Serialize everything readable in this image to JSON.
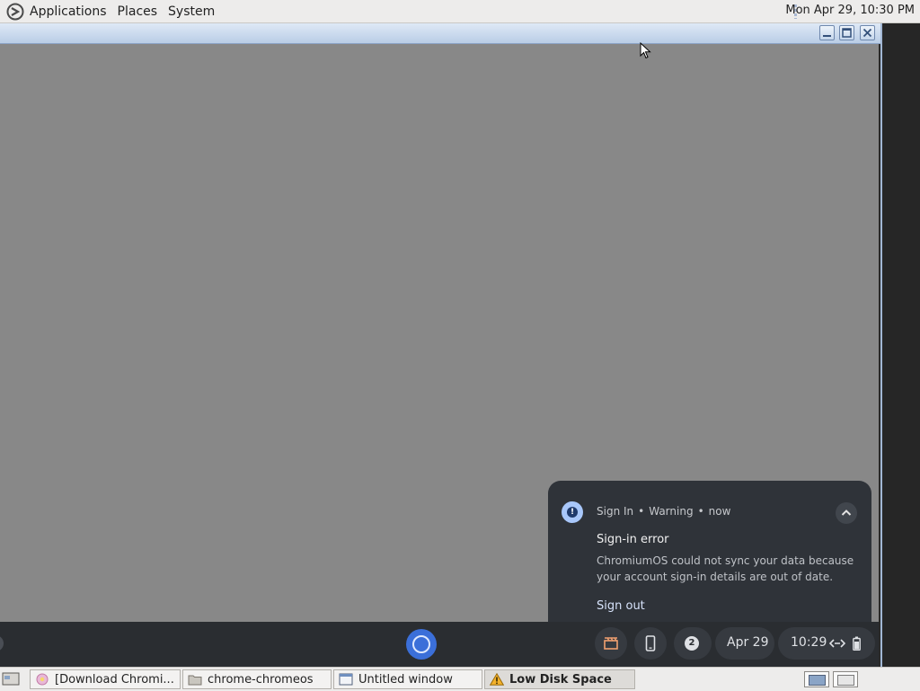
{
  "top_panel": {
    "menus": [
      "Applications",
      "Places",
      "System"
    ],
    "clock": "Mon Apr 29, 10:30 PM"
  },
  "notification": {
    "source": "Sign In",
    "severity": "Warning",
    "time": "now",
    "title": "Sign-in error",
    "message": "ChromiumOS could not sync your data because your account sign-in details are out of date.",
    "action": "Sign out",
    "icon": "warning-circle-icon"
  },
  "shelf": {
    "notification_count": "2",
    "date": "Apr 29",
    "time": "10:29"
  },
  "taskbar": {
    "items": [
      {
        "label": "[Download Chromi...",
        "icon": "browser-icon",
        "active": false
      },
      {
        "label": "chrome-chromeos",
        "icon": "folder-icon",
        "active": false
      },
      {
        "label": "Untitled window",
        "icon": "window-icon",
        "active": false
      },
      {
        "label": "Low Disk Space",
        "icon": "warning-triangle-icon",
        "active": true
      }
    ]
  },
  "colors": {
    "desktop_gray": "#888888",
    "notification_bg": "#2f3339",
    "shelf_bg": "#2a2d31",
    "accent_blue": "#a8c7fa"
  }
}
